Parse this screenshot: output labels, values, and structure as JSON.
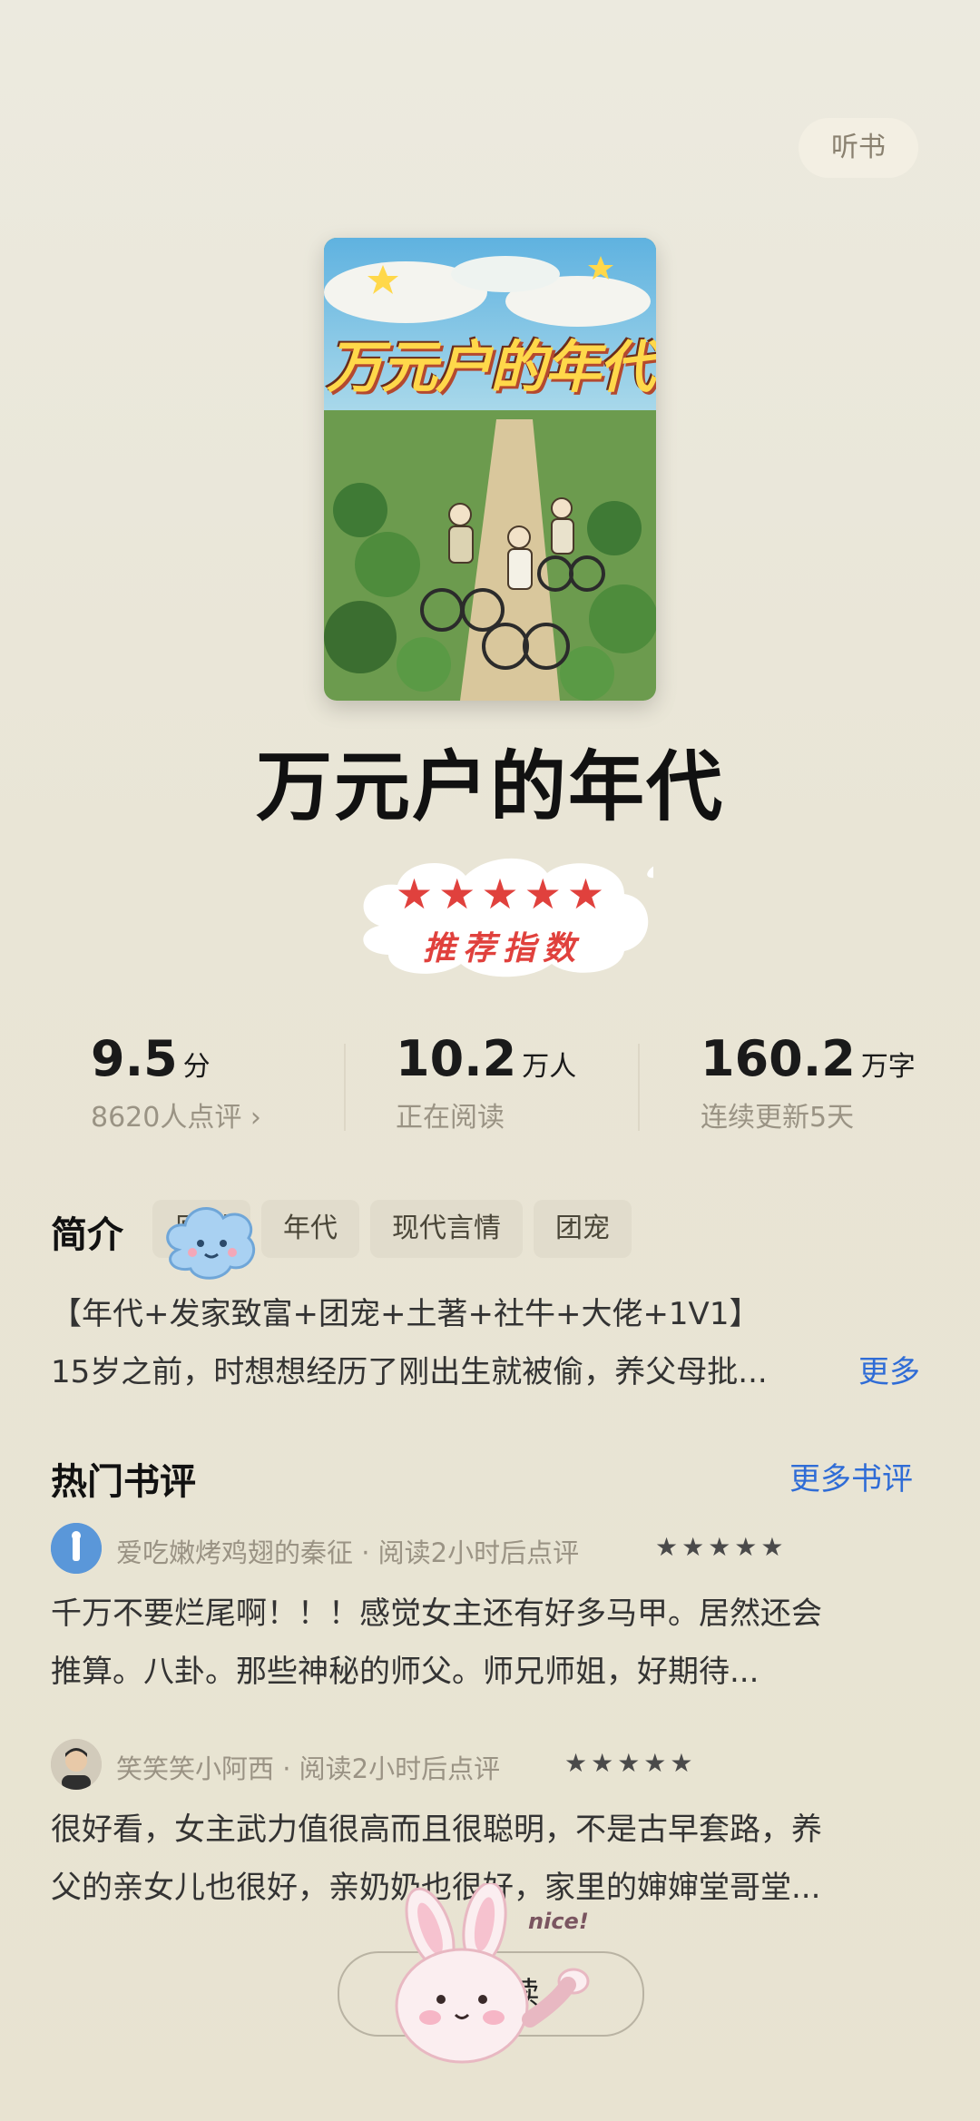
{
  "header": {
    "listen_label": "听书"
  },
  "book": {
    "title": "万元户的年代",
    "cover_title": "万元户的年代"
  },
  "recommend": {
    "stars": "★★★★★",
    "label": "推荐指数",
    "rating": 5
  },
  "stats": [
    {
      "value": "9.5",
      "unit": "分",
      "sub": "8620人点评 ›"
    },
    {
      "value": "10.2",
      "unit": "万人",
      "sub": "正在阅读"
    },
    {
      "value": "160.2",
      "unit": "万字",
      "sub": "连续更新5天"
    }
  ],
  "intro": {
    "title": "简介",
    "tags": [
      "原创",
      "年代",
      "现代言情",
      "团宠"
    ],
    "line1": "【年代+发家致富+团宠+土著+社牛+大佬+1V1】",
    "line2": "15岁之前，时想想经历了刚出生就被偷，养父母批...",
    "more": "更多"
  },
  "reviews": {
    "title": "热门书评",
    "more": "更多书评",
    "items": [
      {
        "meta": "爱吃嫩烤鸡翅的秦征 · 阅读2小时后点评",
        "stars": "★★★★★",
        "rating": 5,
        "line1": "千万不要烂尾啊！！！感觉女主还有好多马甲。居然还会",
        "line2": "推算。八卦。那些神秘的师父。师兄师姐，好期待..."
      },
      {
        "meta": "笑笑笑小阿西 · 阅读2小时后点评",
        "stars": "★★★★★",
        "rating": 5,
        "line1": "很好看，女主武力值很高而且很聪明，不是古早套路，养",
        "line2": "父的亲女儿也很好，亲奶奶也很好，家里的婶婶堂哥堂..."
      }
    ]
  },
  "bottom": {
    "read_label": "← 阅读",
    "sticker_text": "nice!"
  }
}
